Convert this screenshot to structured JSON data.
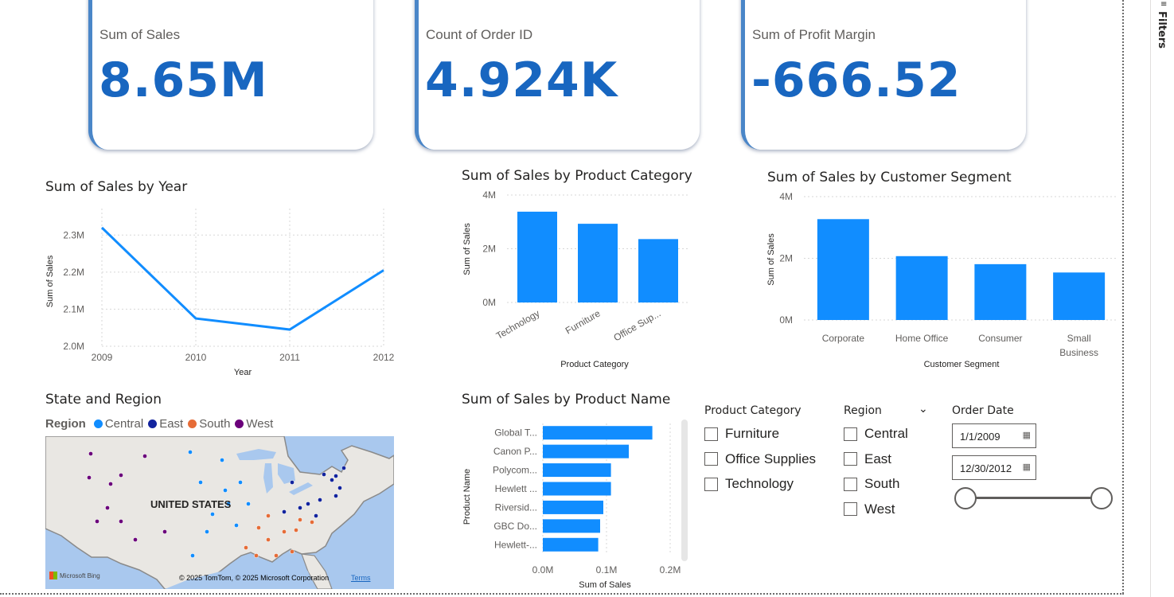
{
  "sidebar": {
    "filters_label": "Filters"
  },
  "kpis": {
    "sales": {
      "label": "Sum of Sales",
      "value": "8.65M"
    },
    "orders": {
      "label": "Count of Order ID",
      "value": "4.924K"
    },
    "margin": {
      "label": "Sum of Profit Margin",
      "value": "-666.52"
    }
  },
  "chart_data": [
    {
      "type": "line",
      "title": "Sum of Sales by Year",
      "xlabel": "Year",
      "ylabel": "Sum of Sales",
      "x": [
        "2009",
        "2010",
        "2011",
        "2012"
      ],
      "values": [
        2.32,
        2.075,
        2.045,
        2.205
      ],
      "value_unit": "M",
      "y_ticks": [
        "2.0M",
        "2.1M",
        "2.2M",
        "2.3M"
      ],
      "ylim": [
        2.0,
        2.35
      ],
      "grid": true,
      "color": "#118dff"
    },
    {
      "type": "bar",
      "title": "Sum of Sales by Product Category",
      "xlabel": "Product Category",
      "ylabel": "Sum of Sales",
      "categories": [
        "Technology",
        "Furniture",
        "Office Sup..."
      ],
      "values": [
        3.38,
        2.93,
        2.36
      ],
      "value_unit": "M",
      "y_ticks": [
        "0M",
        "2M",
        "4M"
      ],
      "ylim": [
        0,
        4
      ],
      "grid": true,
      "color": "#118dff"
    },
    {
      "type": "bar",
      "title": "Sum of Sales by Customer Segment",
      "xlabel": "Customer Segment",
      "ylabel": "Sum of Sales",
      "categories": [
        "Corporate",
        "Home Office",
        "Consumer",
        "Small Business"
      ],
      "values": [
        3.27,
        2.07,
        1.81,
        1.54
      ],
      "value_unit": "M",
      "y_ticks": [
        "0M",
        "2M",
        "4M"
      ],
      "ylim": [
        0,
        4
      ],
      "grid": true,
      "color": "#118dff"
    },
    {
      "type": "bar",
      "orientation": "horizontal",
      "title": "Sum of Sales by Product Name",
      "xlabel": "Sum of Sales",
      "ylabel": "Product Name",
      "categories": [
        "Global T...",
        "Canon P...",
        "Polycom...",
        "Hewlett ...",
        "Riversid...",
        "GBC Do...",
        "Hewlett-..."
      ],
      "values": [
        0.172,
        0.135,
        0.107,
        0.107,
        0.095,
        0.09,
        0.087
      ],
      "value_unit": "M",
      "x_ticks": [
        "0.0M",
        "0.1M",
        "0.2M"
      ],
      "xlim": [
        0,
        0.2
      ],
      "grid": true,
      "color": "#118dff"
    }
  ],
  "map": {
    "title": "State and Region",
    "legend_label": "Region",
    "country_label": "UNITED STATES",
    "bing_label": "Microsoft Bing",
    "copyright": "© 2025 TomTom, © 2025 Microsoft Corporation",
    "terms": "Terms",
    "regions": [
      {
        "name": "Central",
        "color": "#118dff"
      },
      {
        "name": "East",
        "color": "#12239e"
      },
      {
        "name": "South",
        "color": "#e66c37"
      },
      {
        "name": "West",
        "color": "#6b007b"
      }
    ]
  },
  "slicers": {
    "category": {
      "title": "Product Category",
      "items": [
        "Furniture",
        "Office Supplies",
        "Technology"
      ]
    },
    "region": {
      "title": "Region",
      "items": [
        "Central",
        "East",
        "South",
        "West"
      ]
    },
    "date": {
      "title": "Order Date",
      "start": "1/1/2009",
      "end": "12/30/2012"
    }
  }
}
